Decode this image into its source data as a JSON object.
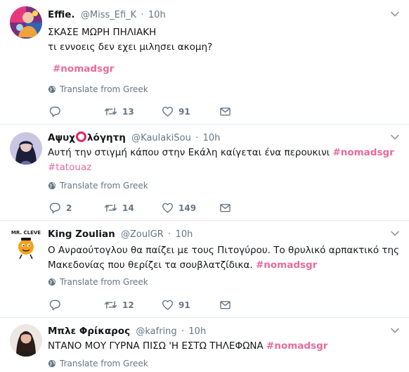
{
  "translate_label": "Translate from Greek",
  "colors": {
    "hashtag": "#e86a9c",
    "meta": "#657786",
    "name": "#14171a",
    "divider": "#e6ecf0"
  },
  "icons": [
    "chevron-down-icon",
    "globe-icon",
    "reply-icon",
    "retweet-icon",
    "heart-icon",
    "envelope-icon"
  ],
  "tweets": [
    {
      "name": "Effie.",
      "handle": "@Miss_Efi_K",
      "separator": "·",
      "time": "10h",
      "lines": [
        "ΣΚΑΣΕ ΜΩΡΗ ΠΗΛΙΑΚΗ",
        "τι εννοεις δεν εχει μιλησει ακομη?"
      ],
      "hashtag": "#nomadsgr",
      "replies": "",
      "retweets": "13",
      "likes": "91"
    },
    {
      "name_prefix": "Αψυχ",
      "name_suffix": "λόγητη",
      "handle": "@KaulakiSou",
      "separator": "·",
      "time": "10h",
      "line1": "Αυτή την στιγμή κάπου στην Εκάλη καίγεται ένα περουκινι",
      "hashtag": "#nomadsgr",
      "hashtag2": "#tatouaz",
      "replies": "2",
      "retweets": "14",
      "likes": "149"
    },
    {
      "name": "King Zoulian",
      "handle": "@ZoulGR",
      "separator": "·",
      "time": "10h",
      "avatar_text": "MR. CLEVE",
      "line1": "Ο Ανραούτογλου θα παίζει με τους Πιτογύρου. Το θρυλικό αρπακτικό της",
      "line2": "Μακεδονίας που θερίζει τα σουβλατζίδικα.",
      "hashtag": "#nomadsgr",
      "replies": "",
      "retweets": "12",
      "likes": "91"
    },
    {
      "name": "Μπλε Φρίκαρος",
      "handle": "@kafring",
      "separator": "·",
      "time": "10h",
      "line1": "ΝΤΑΝΟ ΜΟΥ ΓΥΡΝΑ ΠΙΣΩ 'Η ΕΣΤΩ ΤΗΛΕΦΩΝΑ",
      "hashtag": "#nomadsgr"
    }
  ]
}
